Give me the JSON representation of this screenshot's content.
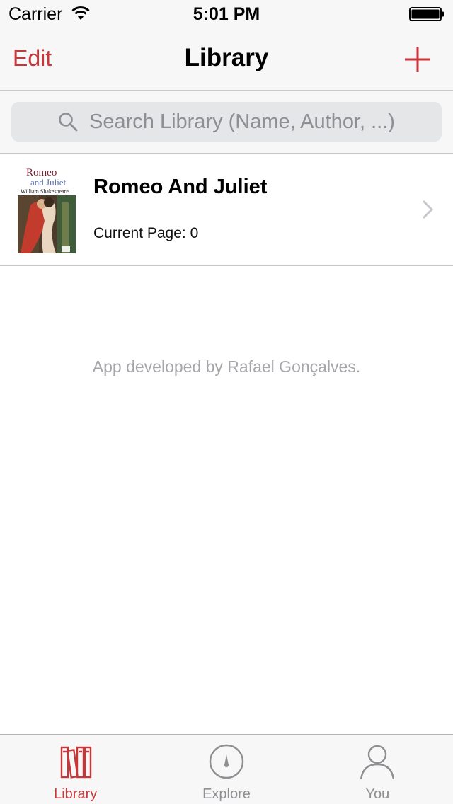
{
  "status_bar": {
    "carrier": "Carrier",
    "time": "5:01 PM"
  },
  "nav": {
    "edit_label": "Edit",
    "title": "Library",
    "add_icon": "plus-icon"
  },
  "search": {
    "placeholder": "Search Library (Name, Author, ...)"
  },
  "books": [
    {
      "title": "Romeo And Juliet",
      "current_page_label": "Current Page: 0",
      "cover": {
        "line1": "Romeo",
        "line2": "and Juliet",
        "author": "William Shakespeare"
      }
    }
  ],
  "footer": {
    "credit": "App developed by Rafael Gonçalves."
  },
  "tabs": [
    {
      "label": "Library",
      "icon": "library-icon",
      "active": true
    },
    {
      "label": "Explore",
      "icon": "compass-icon",
      "active": false
    },
    {
      "label": "You",
      "icon": "person-icon",
      "active": false
    }
  ],
  "colors": {
    "accent": "#c8363a",
    "inactive": "#8e8e93",
    "bar_background": "#f7f7f7"
  }
}
